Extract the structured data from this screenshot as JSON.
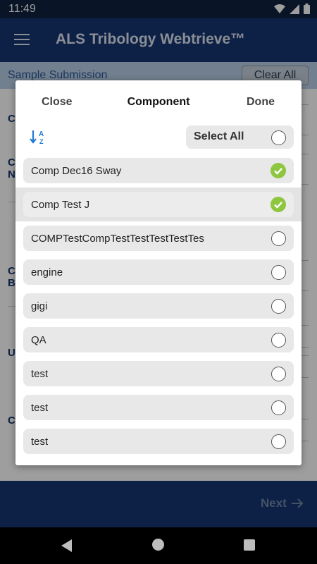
{
  "status": {
    "time": "11:49"
  },
  "app": {
    "title": "ALS Tribology Webtrieve™"
  },
  "subbar": {
    "title": "Sample Submission",
    "clear_all": "Clear All"
  },
  "background_labels": [
    "C",
    "C\nN",
    "C\nB",
    "U",
    "C"
  ],
  "footer": {
    "next": "Next"
  },
  "dialog": {
    "close": "Close",
    "title": "Component",
    "done": "Done",
    "select_all": "Select All",
    "sort_icon_text": {
      "top": "A",
      "bottom": "Z"
    },
    "items": [
      {
        "label": "Comp Dec16 Sway",
        "checked": true,
        "highlight": false
      },
      {
        "label": "Comp Test J",
        "checked": true,
        "highlight": true
      },
      {
        "label": "COMPTestCompTestTestTestTestTes",
        "checked": false,
        "highlight": false
      },
      {
        "label": "engine",
        "checked": false,
        "highlight": false
      },
      {
        "label": "gigi",
        "checked": false,
        "highlight": false
      },
      {
        "label": "QA",
        "checked": false,
        "highlight": false
      },
      {
        "label": "test",
        "checked": false,
        "highlight": false
      },
      {
        "label": "test",
        "checked": false,
        "highlight": false
      },
      {
        "label": "test",
        "checked": false,
        "highlight": false
      }
    ]
  },
  "colors": {
    "primary": "#153470",
    "accent_check": "#8ec63f",
    "subbar": "#b8cde6"
  }
}
